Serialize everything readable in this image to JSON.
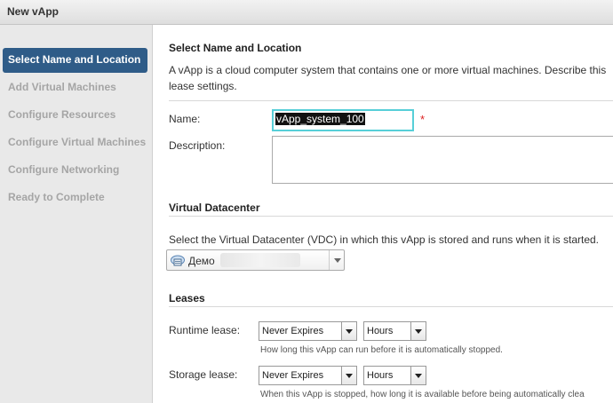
{
  "window": {
    "title": "New vApp"
  },
  "steps": [
    "Select Name and Location",
    "Add Virtual Machines",
    "Configure Resources",
    "Configure Virtual Machines",
    "Configure Networking",
    "Ready to Complete"
  ],
  "section1": {
    "title": "Select Name and Location",
    "intro_line1": "A vApp is a cloud computer system that contains one or more virtual machines. Describe this",
    "intro_line2": "lease settings."
  },
  "form": {
    "name_label": "Name:",
    "name_value": "vApp_system_100",
    "required_mark": "*",
    "description_label": "Description:",
    "description_value": ""
  },
  "vdc": {
    "title": "Virtual Datacenter",
    "help": "Select the Virtual Datacenter (VDC) in which this vApp is stored and runs when it is started.",
    "selected": "Демо"
  },
  "leases": {
    "title": "Leases",
    "runtime_label": "Runtime lease:",
    "runtime_value": "Never Expires",
    "runtime_unit": "Hours",
    "runtime_help": "How long this vApp can run before it is automatically stopped.",
    "storage_label": "Storage lease:",
    "storage_value": "Never Expires",
    "storage_unit": "Hours",
    "storage_help": "When this vApp is stopped, how long it is available before being automatically clea"
  },
  "colors": {
    "active_step": "#2f5c88",
    "focus_border": "#57cfd8",
    "required": "#d22222"
  }
}
